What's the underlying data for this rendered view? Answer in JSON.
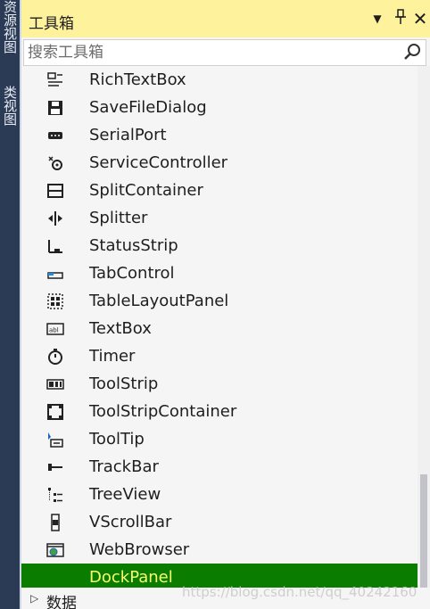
{
  "side_tabs": [
    "资源视图",
    "类视图"
  ],
  "window": {
    "title": "工具箱",
    "dropdown_glyph": "▼",
    "pin_glyph": "📌",
    "close_glyph": "✕"
  },
  "search": {
    "placeholder": "搜索工具箱"
  },
  "items": [
    {
      "label": "RichTextBox",
      "icon": "richtextbox-icon"
    },
    {
      "label": "SaveFileDialog",
      "icon": "savefiledialog-icon"
    },
    {
      "label": "SerialPort",
      "icon": "serialport-icon"
    },
    {
      "label": "ServiceController",
      "icon": "servicecontroller-icon"
    },
    {
      "label": "SplitContainer",
      "icon": "splitcontainer-icon"
    },
    {
      "label": "Splitter",
      "icon": "splitter-icon"
    },
    {
      "label": "StatusStrip",
      "icon": "statusstrip-icon"
    },
    {
      "label": "TabControl",
      "icon": "tabcontrol-icon"
    },
    {
      "label": "TableLayoutPanel",
      "icon": "tablelayoutpanel-icon"
    },
    {
      "label": "TextBox",
      "icon": "textbox-icon"
    },
    {
      "label": "Timer",
      "icon": "timer-icon"
    },
    {
      "label": "ToolStrip",
      "icon": "toolstrip-icon"
    },
    {
      "label": "ToolStripContainer",
      "icon": "toolstripcontainer-icon"
    },
    {
      "label": "ToolTip",
      "icon": "tooltip-icon"
    },
    {
      "label": "TrackBar",
      "icon": "trackbar-icon"
    },
    {
      "label": "TreeView",
      "icon": "treeview-icon"
    },
    {
      "label": "VScrollBar",
      "icon": "vscrollbar-icon"
    },
    {
      "label": "WebBrowser",
      "icon": "webbrowser-icon"
    },
    {
      "label": "DockPanel",
      "icon": "dockpanel-icon",
      "selected": true
    }
  ],
  "footer": {
    "arrow": "▷",
    "label": "数据"
  },
  "watermark": "https://blog.csdn.net/qq_40242160",
  "colors": {
    "selected_bg": "#0a7d00",
    "selected_text": "#f6ff6b",
    "titlebar": "#fff29d",
    "highlight": "#f2ff2a"
  }
}
